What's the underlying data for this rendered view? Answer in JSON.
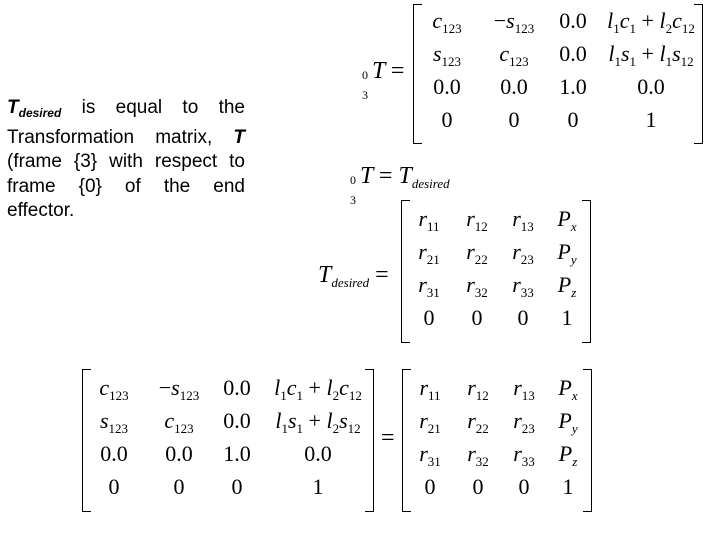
{
  "paragraph": {
    "symbol": "T",
    "symbol_sub": "desired",
    "text_1": " is equal to the Transformation matrix, ",
    "symbol_2": "T",
    "text_2": " (frame {3} with respect to frame {0} of the end effector."
  },
  "eq1": {
    "lhs": {
      "sup": "0",
      "sub": "3",
      "base": "T",
      "op": "="
    },
    "rows": [
      [
        "c123",
        "−s123",
        "0.0",
        "l1c1 + l2c12"
      ],
      [
        "s123",
        "c123",
        "0.0",
        "l1s1 + l1s12"
      ],
      [
        "0.0",
        "0.0",
        "1.0",
        "0.0"
      ],
      [
        "0",
        "0",
        "0",
        "1"
      ]
    ]
  },
  "eq2": {
    "lhs_sup": "0",
    "lhs_sub": "3",
    "lhs": "T",
    "op": "=",
    "rhs": "T",
    "rhs_sub": "desired"
  },
  "eq3": {
    "lhs": "T",
    "lhs_sub": "desired",
    "op": "=",
    "rows": [
      [
        "r11",
        "r12",
        "r13",
        "Px"
      ],
      [
        "r21",
        "r22",
        "r23",
        "Py"
      ],
      [
        "r31",
        "r32",
        "r33",
        "Pz"
      ],
      [
        "0",
        "0",
        "0",
        "1"
      ]
    ]
  },
  "eq4": {
    "op": "=",
    "left_rows": [
      [
        "c123",
        "−s123",
        "0.0",
        "l1c1 + l2c12"
      ],
      [
        "s123",
        "c123",
        "0.0",
        "l1s1 + l2s12"
      ],
      [
        "0.0",
        "0.0",
        "1.0",
        "0.0"
      ],
      [
        "0",
        "0",
        "0",
        "1"
      ]
    ],
    "right_rows": [
      [
        "r11",
        "r12",
        "r13",
        "Px"
      ],
      [
        "r21",
        "r22",
        "r23",
        "Py"
      ],
      [
        "r31",
        "r32",
        "r33",
        "Pz"
      ],
      [
        "0",
        "0",
        "0",
        "1"
      ]
    ]
  }
}
